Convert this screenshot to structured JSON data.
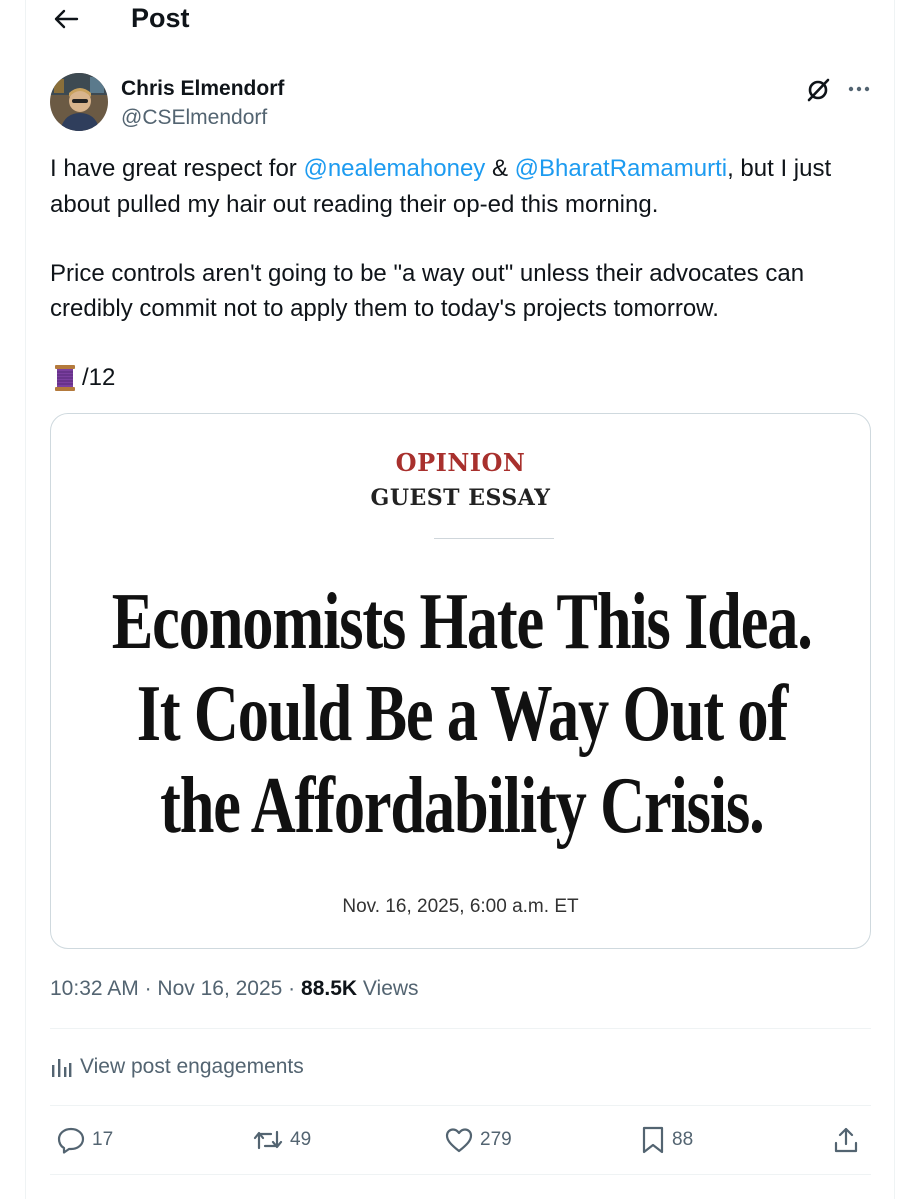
{
  "header": {
    "title": "Post"
  },
  "author": {
    "name": "Chris Elmendorf",
    "handle": "@CSElmendorf"
  },
  "tweet": {
    "p1_part1": "I have great respect for ",
    "mention1": "@nealemahoney",
    "p1_amp": " & ",
    "mention2": "@BharatRamamurti",
    "p1_part2": ", but I just",
    "p1_line2": "about pulled my hair out reading their op-ed this morning.",
    "p2_line1": "Price controls aren't going to be \"a way out\" unless their advocates can",
    "p2_line2": "credibly commit not to apply them to today's projects tomorrow.",
    "thread_marker": "/12"
  },
  "card": {
    "kicker": "OPINION",
    "subkicker": "GUEST ESSAY",
    "headline_lines": [
      "Economists Hate This Idea.",
      "It Could Be a Way Out of",
      "the Affordability Crisis."
    ],
    "date": "Nov. 16, 2025, 6:00 a.m. ET"
  },
  "meta": {
    "time": "10:32 AM",
    "sep1": " · ",
    "date": "Nov 16, 2025",
    "sep2": " · ",
    "views_count": "88.5K",
    "views_label": " Views"
  },
  "engagements_label": "View post engagements",
  "actions": {
    "replies": "17",
    "reposts": "49",
    "likes": "279",
    "bookmarks": "88"
  },
  "colors": {
    "link": "#1d9bf0",
    "secondary_text": "#536471",
    "kicker_red": "#a8302d",
    "border": "#cfd9de"
  },
  "icons": [
    "back-arrow-icon",
    "grok-icon",
    "more-icon",
    "thread-spool-icon",
    "bar-chart-icon",
    "reply-icon",
    "repost-icon",
    "like-icon",
    "bookmark-icon",
    "share-icon"
  ]
}
